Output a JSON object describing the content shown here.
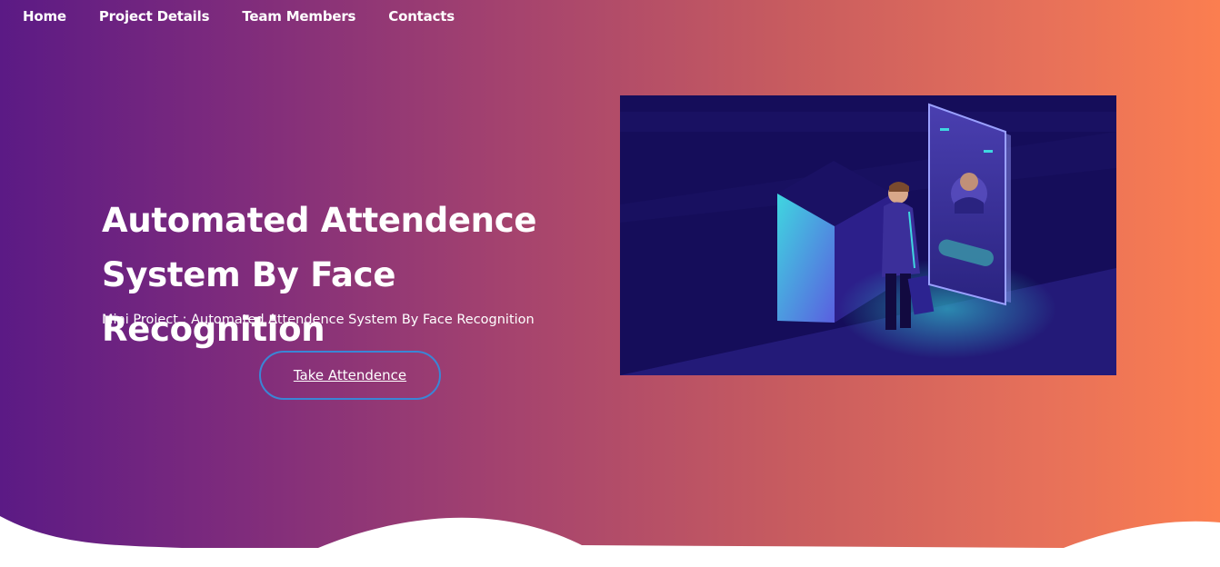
{
  "nav": {
    "items": [
      {
        "label": "Home"
      },
      {
        "label": "Project Details"
      },
      {
        "label": "Team Members"
      },
      {
        "label": "Contacts"
      }
    ]
  },
  "hero": {
    "title_line1": "Automated Attendence",
    "title_line2": "System By Face Recognition",
    "subtitle": "Mini Project : Automated Attendence System By Face Recognition",
    "cta_label": "Take Attendence"
  },
  "illustration": {
    "icon": "face-recognition-illustration"
  },
  "colors": {
    "gradient_start": "#5b1a85",
    "gradient_end": "#fb7e50",
    "button_border": "#3a86d6",
    "illustration_bg": "#1a1160",
    "accent_cyan": "#3fd6e0"
  }
}
